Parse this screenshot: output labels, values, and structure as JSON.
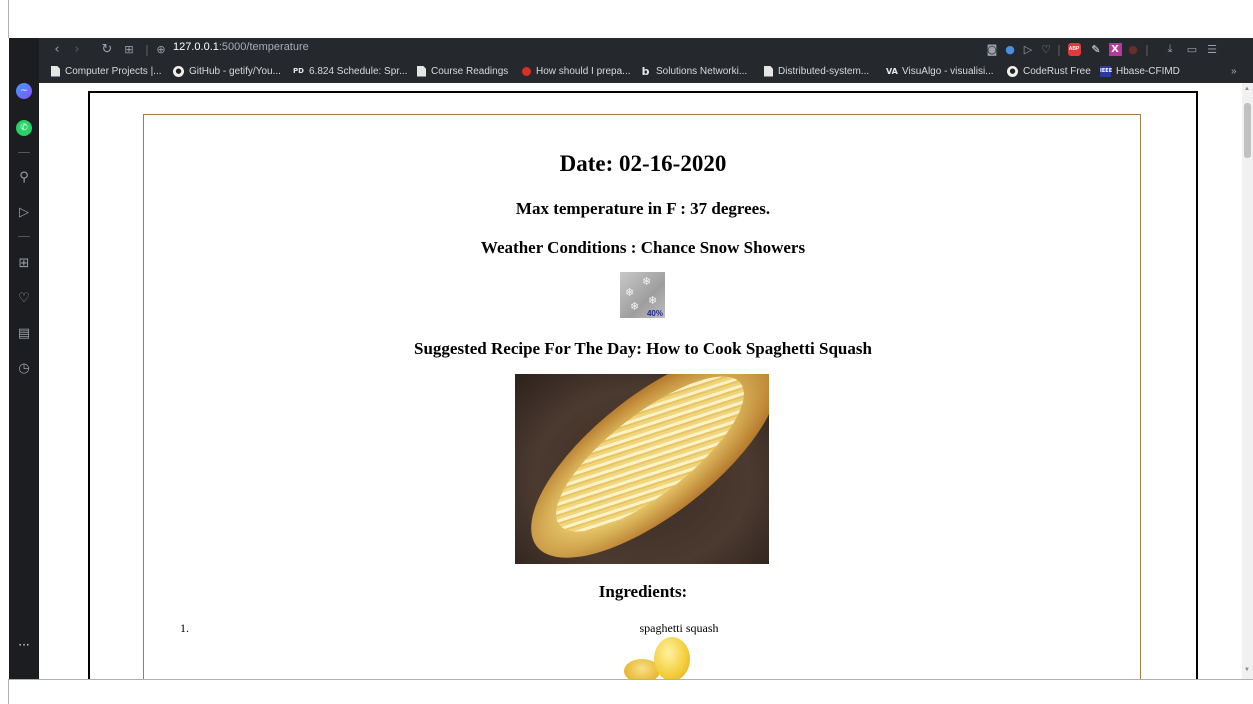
{
  "browser": {
    "url_host": "127.0.0.1",
    "url_path": ":5000/temperature",
    "bookmarks": [
      {
        "label": "Computer Projects |...",
        "icon": "document-icon"
      },
      {
        "label": "GitHub - getify/You...",
        "icon": "github-icon"
      },
      {
        "label": "6.824 Schedule: Spr...",
        "icon": "pdos-icon"
      },
      {
        "label": "Course Readings",
        "icon": "document-icon"
      },
      {
        "label": "How should I prepa...",
        "icon": "quora-icon"
      },
      {
        "label": "Solutions Networki...",
        "icon": "b-icon"
      },
      {
        "label": "Distributed-system...",
        "icon": "document-icon"
      },
      {
        "label": "VisuAlgo - visualisi...",
        "icon": "visualgo-icon"
      },
      {
        "label": "CodeRust Free",
        "icon": "github-icon"
      },
      {
        "label": "Hbase-CFIMD",
        "icon": "ieee-icon"
      }
    ],
    "overflow_label": "»"
  },
  "page": {
    "date_heading": "Date: 02-16-2020",
    "temperature_heading": "Max temperature in F : 37 degrees.",
    "conditions_heading": "Weather Conditions : Chance Snow Showers",
    "weather_icon_percent": "40%",
    "recipe_heading": "Suggested Recipe For The Day: How to Cook Spaghetti Squash",
    "ingredients_heading": "Ingredients:",
    "ingredients": [
      {
        "number": "1.",
        "name": "spaghetti squash"
      }
    ]
  },
  "sidebar": {
    "more_label": "···"
  },
  "colors": {
    "browser_chrome": "#25282d",
    "sidebar": "#1b1d21",
    "inner_border": "#a0804a",
    "weather_percent": "#1a2a9a"
  }
}
